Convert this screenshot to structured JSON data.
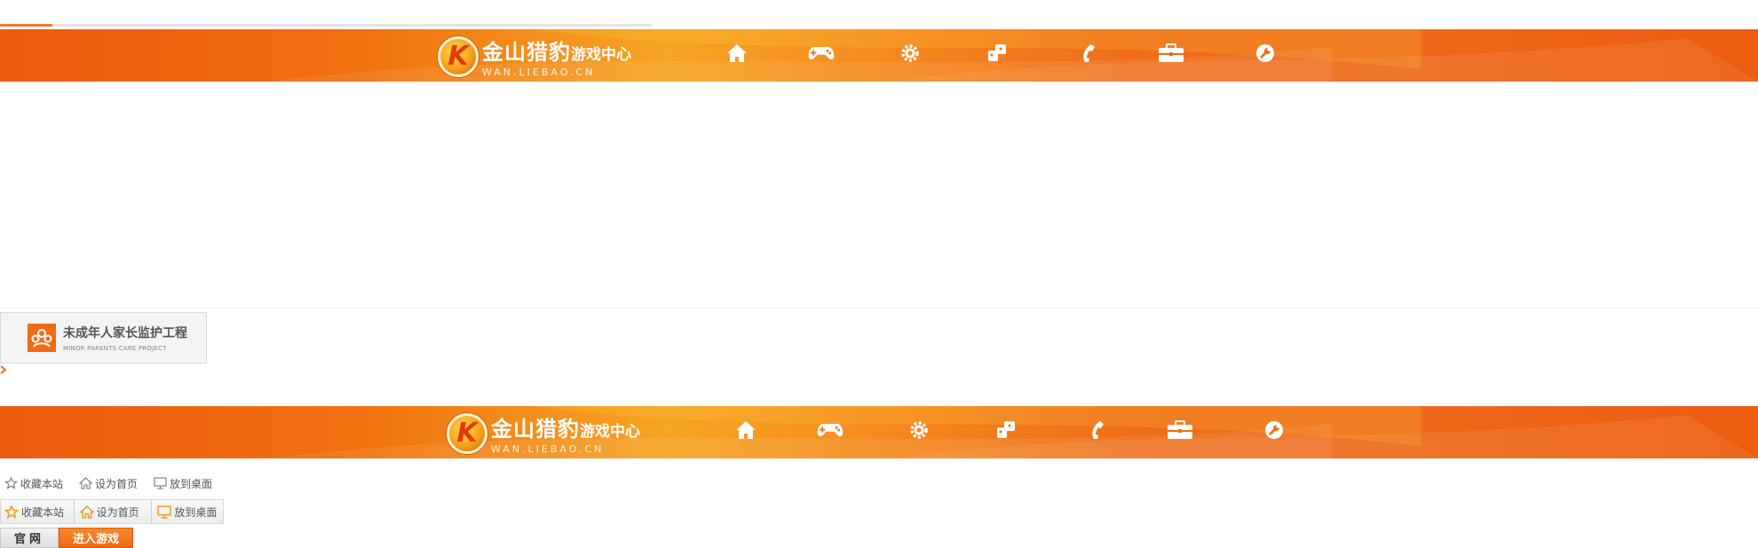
{
  "progress": {
    "fill_fraction": 0.08
  },
  "banner": {
    "logo_letter": "K",
    "logo_cn_big": "金山猎豹",
    "logo_cn_small": "游戏中心",
    "logo_en": "WAN.LIEBAO.CN",
    "nav_icons": [
      "home-icon",
      "gamepad-icon",
      "gear-icon",
      "puzzle-icon",
      "phone-icon",
      "toolbox-icon",
      "wrench-icon"
    ]
  },
  "minor_care": {
    "title": "未成年人家长监护工程",
    "subtitle": "MINOR PARENTS CARE PROJECT"
  },
  "favorites": {
    "bookmark": "收藏本站",
    "set_home": "设为首页",
    "to_desktop": "放到桌面"
  },
  "tabs": {
    "official": "官网",
    "enter_game": "进入游戏"
  },
  "colors": {
    "brand_orange": "#ee6a12",
    "accent_yellow": "#f7a524"
  }
}
